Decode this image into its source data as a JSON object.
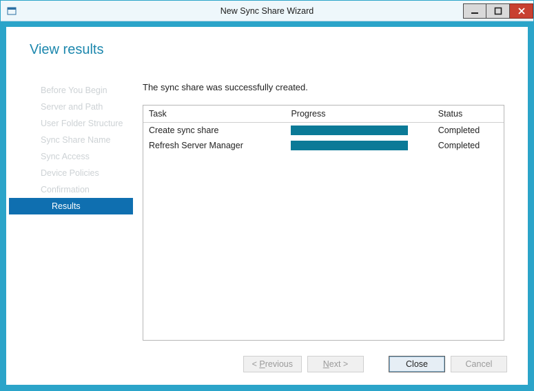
{
  "window": {
    "title": "New Sync Share Wizard"
  },
  "page": {
    "title": "View results"
  },
  "sidebar": {
    "items": [
      {
        "label": "Before You Begin",
        "active": false
      },
      {
        "label": "Server and Path",
        "active": false
      },
      {
        "label": "User Folder Structure",
        "active": false
      },
      {
        "label": "Sync Share Name",
        "active": false
      },
      {
        "label": "Sync Access",
        "active": false
      },
      {
        "label": "Device Policies",
        "active": false
      },
      {
        "label": "Confirmation",
        "active": false
      },
      {
        "label": "Results",
        "active": true
      }
    ]
  },
  "main": {
    "status_message": "The sync share was successfully created.",
    "columns": {
      "task": "Task",
      "progress": "Progress",
      "status": "Status"
    },
    "rows": [
      {
        "task": "Create sync share",
        "progress": 100,
        "status": "Completed"
      },
      {
        "task": "Refresh Server Manager",
        "progress": 100,
        "status": "Completed"
      }
    ]
  },
  "buttons": {
    "previous": "< Previous",
    "next": "Next >",
    "close": "Close",
    "cancel": "Cancel",
    "previous_label": "< Previous",
    "next_prefix": "N",
    "next_rest": "ext >",
    "prev_prefix": "< ",
    "prev_underline": "P",
    "prev_rest": "revious"
  }
}
